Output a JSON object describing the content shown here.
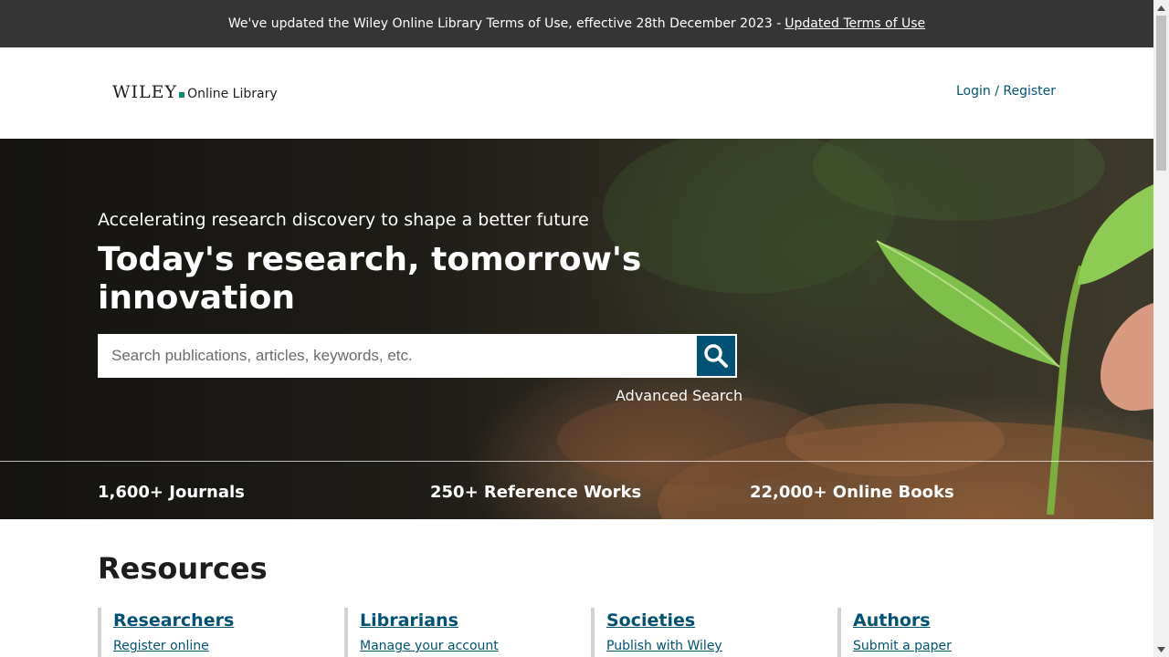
{
  "notice": {
    "text": "We've updated the Wiley Online Library Terms of Use, effective 28th December 2023 -",
    "link": "Updated Terms of Use"
  },
  "header": {
    "logo_brand": "WILEY",
    "logo_product": "Online Library",
    "login": "Login / Register"
  },
  "hero": {
    "tagline": "Accelerating research discovery to shape a better future",
    "headline": "Today's research, tomorrow's innovation",
    "search_placeholder": "Search publications, articles, keywords, etc.",
    "search_icon": "search-icon",
    "advanced_search": "Advanced Search",
    "stats": [
      "1,600+ Journals",
      "250+ Reference Works",
      "22,000+ Online Books"
    ]
  },
  "resources": {
    "title": "Resources",
    "columns": [
      {
        "heading": "Researchers",
        "link": "Register online"
      },
      {
        "heading": "Librarians",
        "link": "Manage your account"
      },
      {
        "heading": "Societies",
        "link": "Publish with Wiley"
      },
      {
        "heading": "Authors",
        "link": "Submit a paper"
      }
    ]
  },
  "colors": {
    "notice_bg": "#353535",
    "brand_blue": "#005274",
    "logo_green": "#0a8a6e"
  }
}
